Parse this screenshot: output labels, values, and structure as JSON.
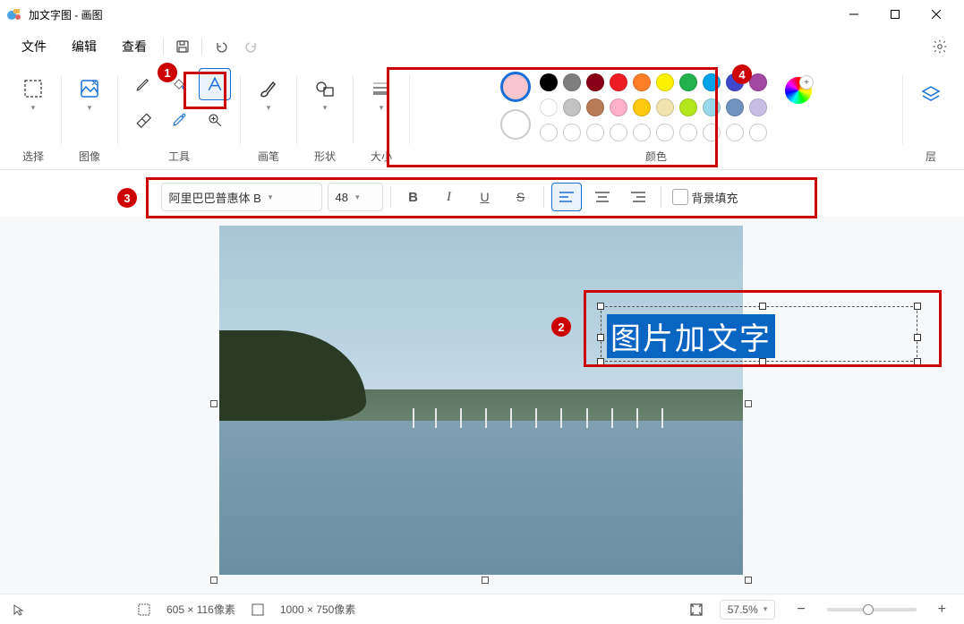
{
  "window": {
    "title": "加文字图 - 画图"
  },
  "menu": {
    "file": "文件",
    "edit": "编辑",
    "view": "查看"
  },
  "ribbon": {
    "select": "选择",
    "image": "图像",
    "tools": "工具",
    "brushes": "画笔",
    "shapes": "形状",
    "size": "大小",
    "colors": "颜色",
    "layers": "层"
  },
  "palette": {
    "row1": [
      "#000000",
      "#7f7f7f",
      "#880015",
      "#ed1c24",
      "#ff7f27",
      "#fff200",
      "#22b14c",
      "#00a2e8",
      "#3f48cc",
      "#a349a4"
    ],
    "row2": [
      "#ffffff",
      "#c3c3c3",
      "#b97a57",
      "#ffaec9",
      "#ffc90e",
      "#efe4b0",
      "#b5e61d",
      "#99d9ea",
      "#7092be",
      "#c8bfe7"
    ],
    "primary": "#f7c5cd",
    "secondary": "#ffffff"
  },
  "text_toolbar": {
    "font": "阿里巴巴普惠体 B",
    "size": "48",
    "bg_fill": "背景填充"
  },
  "canvas": {
    "typed_text": "图片加文字"
  },
  "annotations": {
    "n1": "1",
    "n2": "2",
    "n3": "3",
    "n4": "4"
  },
  "status": {
    "selection": "605 × 116像素",
    "canvas": "1000 × 750像素",
    "zoom": "57.5%"
  }
}
